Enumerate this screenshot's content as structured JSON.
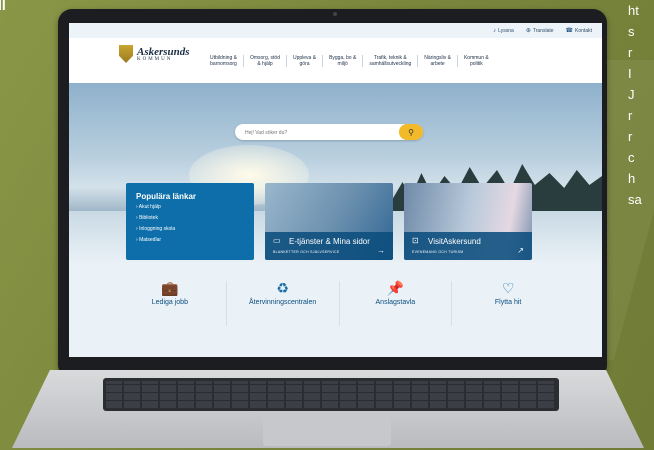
{
  "side_left_text": "ll",
  "side_right_lines": [
    "ht",
    "s",
    "r",
    "",
    "I",
    "J",
    "r",
    "r",
    "c",
    "h",
    "sa"
  ],
  "site": {
    "utility": [
      {
        "icon": "lyssna-icon",
        "label": "Lyssna"
      },
      {
        "icon": "globe-icon",
        "label": "Translate"
      },
      {
        "icon": "phone-icon",
        "label": "Kontakt"
      }
    ],
    "logo_name": "Askersunds",
    "logo_sub": "KOMMUN",
    "nav": [
      "Utbildning &\nbarnomsorg",
      "Omsorg, stöd\n& hjälp",
      "Uppleva &\ngöra",
      "Bygga, bo &\nmiljö",
      "Trafik, teknik &\nsamhällsutveckling",
      "Näringsliv &\narbete",
      "Kommun &\npolitik"
    ],
    "search_placeholder": "Hej! Vad söker du?",
    "popular_title": "Populära länkar",
    "popular_links": [
      "Akut hjälp",
      "Bibliotek",
      "Inloggning skola",
      "Matsedlar"
    ],
    "card1_title": "E-tjänster & Mina sidor",
    "card1_sub": "BLANKETTER OCH SJÄLVSERVICE",
    "card2_title": "VisitAskersund",
    "card2_sub": "EVENEMANG OCH TURISM",
    "quick_links": [
      {
        "icon": "briefcase-icon",
        "label": "Lediga jobb"
      },
      {
        "icon": "recycle-icon",
        "label": "Återvinningscentralen"
      },
      {
        "icon": "pin-icon",
        "label": "Anslagstavla"
      },
      {
        "icon": "heart-icon",
        "label": "Flytta hit"
      }
    ]
  }
}
